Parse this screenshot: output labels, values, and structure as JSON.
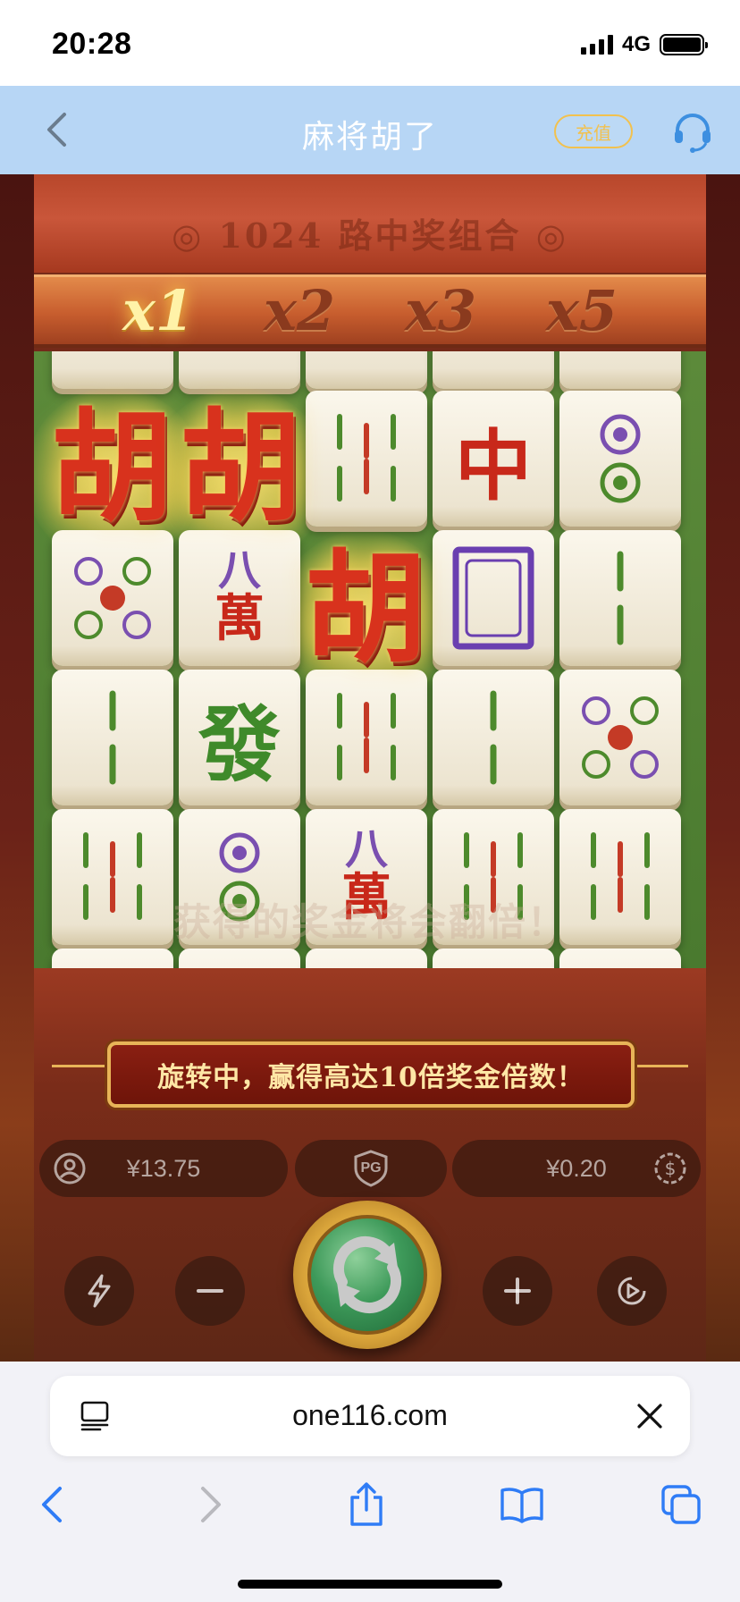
{
  "status_bar": {
    "time": "20:28",
    "network": "4G"
  },
  "header": {
    "title": "麻将胡了",
    "recharge_label": "充值"
  },
  "game": {
    "ways_banner": "◎ 1024 路中奖组合 ◎",
    "multipliers": [
      {
        "label": "x1",
        "active": true
      },
      {
        "label": "x2",
        "active": false
      },
      {
        "label": "x3",
        "active": false
      },
      {
        "label": "x5",
        "active": false
      }
    ],
    "winning_symbol": "胡",
    "tile_glyphs": {
      "zhong": "中",
      "fa": "發",
      "ba": "八",
      "wan": "萬"
    },
    "watermark": "获得的奖金将会翻倍！",
    "promo_text": "旋转中，赢得高达10倍奖金倍数！",
    "balance": "¥13.75",
    "bet": "¥0.20",
    "provider_badge": "PG"
  },
  "browser": {
    "url": "one116.com"
  },
  "colors": {
    "header_bg": "#b7d6f5",
    "recharge_accent": "#f2c14e",
    "safari_blue": "#2f7cf6",
    "hu_red": "#d8321d"
  },
  "icons": {
    "back": "chevron-left-icon",
    "service": "headset-icon",
    "turbo": "lightning-icon",
    "minus": "minus-icon",
    "plus": "plus-icon",
    "auto": "autoplay-icon",
    "spin": "spin-icon",
    "wallet": "user-icon",
    "coin": "dollar-coin-icon",
    "pg": "pg-shield-icon",
    "tab": "reader-icon",
    "close": "close-icon",
    "share": "share-icon",
    "bookmarks": "book-icon",
    "tabs": "tabs-icon"
  }
}
